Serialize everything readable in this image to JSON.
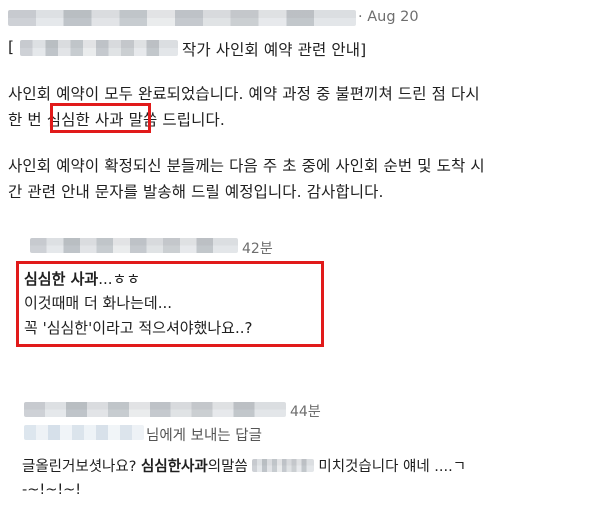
{
  "post": {
    "date": "· Aug 20",
    "bracket_open": "[",
    "title_suffix": "작가 사인회 예약 관련 안내]",
    "para1_line1": "사인회 예약이 모두 완료되었습니다. 예약 과정 중 불편끼쳐 드린 점 다시",
    "para1_line2_pre": "한 번 ",
    "para1_line2_highlight": "심심한 사과",
    "para1_line2_post": " 말씀 드립니다.",
    "para2_line1": "사인회 예약이 확정되신 분들께는 다음 주 초 중에 사인회 순번 및 도착 시",
    "para2_line2": "간 관련 안내 문자를 발송해 드릴 예정입니다. 감사합니다."
  },
  "reply1": {
    "time": "42분",
    "line1_bold": "심심한 사과",
    "line1_rest": "...ㅎㅎ",
    "line2": "이것때매 더 화나는데...",
    "line3": "꼭 '심심한'이라고 적으셔야했나요..?"
  },
  "reply2": {
    "time": "44분",
    "replying_to": "님에게 보내는 답글",
    "line1_pre": "글올린거보셧나요? ",
    "line1_bold": "심심한사과",
    "line1_mid": "의말씀",
    "line1_post": " 미치것습니다 얘네  ....ㄱ",
    "line2": "-~!~!~!"
  },
  "colors": {
    "highlight_border": "#e11a1a",
    "text": "#202020",
    "meta": "#6e6e6e"
  }
}
